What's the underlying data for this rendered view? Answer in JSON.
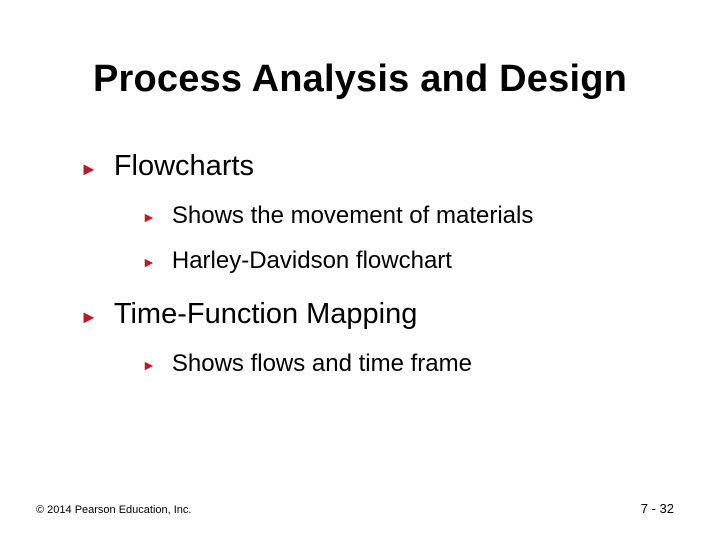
{
  "slide": {
    "title": "Process Analysis and Design",
    "sections": [
      {
        "heading": "Flowcharts",
        "items": [
          "Shows the movement of materials",
          "Harley-Davidson flowchart"
        ]
      },
      {
        "heading": "Time-Function Mapping",
        "items": [
          "Shows flows and time frame"
        ]
      }
    ],
    "footer": {
      "copyright": "© 2014 Pearson Education, Inc.",
      "page": "7 - 32"
    }
  }
}
